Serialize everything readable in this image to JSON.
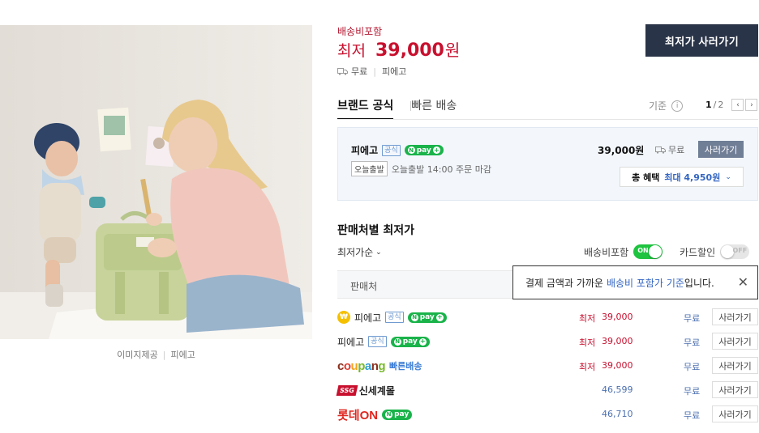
{
  "image_credit": {
    "label": "이미지제공",
    "provider": "피에고"
  },
  "price_header": {
    "shipping_included": "배송비포함",
    "lowest_label": "최저",
    "lowest_price": "39,000",
    "currency": "원",
    "shipping": "무료",
    "seller": "피에고",
    "buy_lowest_button": "최저가 사러가기"
  },
  "tabs": [
    {
      "label": "브랜드 공식",
      "active": true
    },
    {
      "label": "빠른 배송",
      "active": false
    }
  ],
  "basis_label": "기준",
  "pager": {
    "current": "1",
    "total": "2"
  },
  "brand_card": {
    "store": "피에고",
    "official_badge": "공식",
    "npay_label": "pay",
    "today_badge": "오늘출발",
    "today_text": "오늘출발 14:00 주문 마감",
    "price": "39,000원",
    "shipping": "무료",
    "buy_button": "사러가기",
    "benefit_label": "총 혜택",
    "benefit_value": "최대 4,950원"
  },
  "seller_section": {
    "title": "판매처별 최저가",
    "sort_label": "최저가순",
    "toggle_shipping": {
      "label": "배송비포함",
      "state": "ON"
    },
    "toggle_card": {
      "label": "카드할인",
      "state": "OFF"
    },
    "column_seller": "판매처",
    "tooltip": {
      "text": "결제 금액과 가까운",
      "highlight": "배송비 포함가 기준",
      "suffix": "입니다."
    },
    "rows": [
      {
        "seller": "피에고",
        "official": "공식",
        "npay": "pay",
        "price_label": "최저",
        "price": "39,000",
        "shipping": "무료",
        "buy": "사러가기"
      },
      {
        "seller": "피에고",
        "official": "공식",
        "npay": "pay",
        "price_label": "최저",
        "price": "39,000",
        "shipping": "무료",
        "buy": "사러가기"
      },
      {
        "seller": "coupang",
        "extra": "빠른배송",
        "price_label": "최저",
        "price": "39,000",
        "shipping": "무료",
        "buy": "사러가기"
      },
      {
        "seller": "신세계몰",
        "logo": "SSG",
        "price": "46,599",
        "shipping": "무료",
        "buy": "사러가기"
      },
      {
        "seller": "롯데ON",
        "npay": "pay",
        "price": "46,710",
        "shipping": "무료",
        "buy": "사러가기"
      }
    ]
  },
  "colors": {
    "accent_red": "#c8102e",
    "button_dark": "#2a3448",
    "link_blue": "#3466c2",
    "toggle_on": "#1ec43f"
  }
}
